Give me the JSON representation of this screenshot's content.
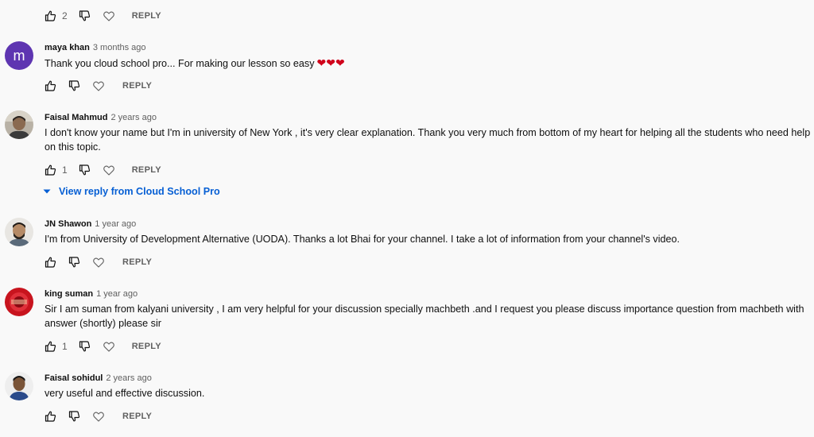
{
  "top_actions": {
    "likes": "2",
    "reply_label": "REPLY"
  },
  "comments": [
    {
      "author": "maya khan",
      "time": "3 months ago",
      "avatar_letter": "m",
      "text": "Thank you cloud school pro... For making our lesson so easy",
      "emoji": "❤❤❤",
      "likes": "",
      "reply_label": "REPLY"
    },
    {
      "author": "Faisal Mahmud",
      "time": "2 years ago",
      "text": "I don't know your name but I'm in university of New York , it's very clear explanation. Thank you very much from bottom of my heart for helping all the students who need help on this topic.",
      "likes": "1",
      "reply_label": "REPLY",
      "view_replies": "View reply from Cloud School Pro"
    },
    {
      "author": "JN Shawon",
      "time": "1 year ago",
      "text": "I'm from University of Development Alternative (UODA). Thanks a lot Bhai for your channel. I take a lot of information from your channel's video.",
      "likes": "",
      "reply_label": "REPLY"
    },
    {
      "author": "king suman",
      "time": "1 year ago",
      "text": "Sir I am suman from kalyani university , I am very helpful for your discussion specially machbeth .and I request you please discuss importance question from machbeth with answer (shortly) please sir",
      "likes": "1",
      "reply_label": "REPLY"
    },
    {
      "author": "Faisal sohidul",
      "time": "2 years ago",
      "text": "very useful and effective discussion.",
      "likes": "",
      "reply_label": "REPLY"
    }
  ],
  "colors": {
    "background": "#f9f9f9",
    "link_blue": "#065fd4",
    "avatar_purple": "#5e35b1",
    "heart_red": "#d0021b"
  }
}
